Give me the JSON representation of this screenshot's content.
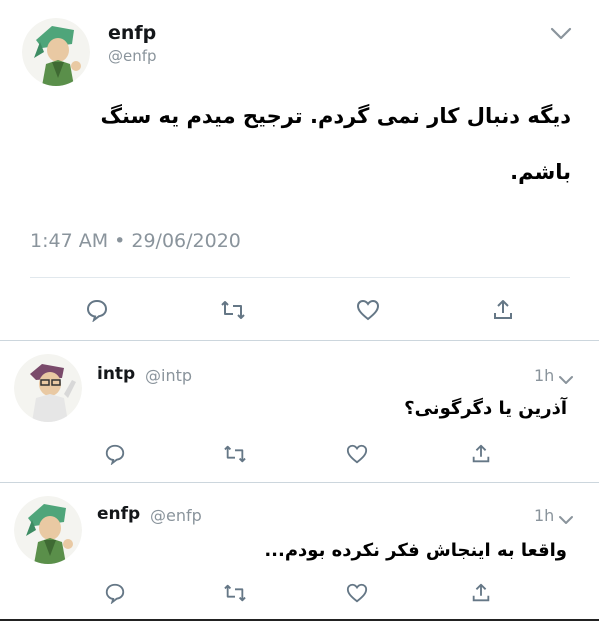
{
  "main_tweet": {
    "display_name": "enfp",
    "handle": "@enfp",
    "text_line1": "دیگه دنبال کار نمی گردم. ترجیح میدم یه سنگ",
    "text_line2": "باشم.",
    "timestamp": "1:47 AM • 29/06/2020",
    "avatar_icon": "enfp-character-avatar",
    "menu_icon": "chevron-down-icon"
  },
  "replies": [
    {
      "display_name": "intp",
      "handle": "@intp",
      "time": "1h",
      "text": "آذرین یا دگرگونی؟",
      "avatar_icon": "intp-character-avatar"
    },
    {
      "display_name": "enfp",
      "handle": "@enfp",
      "time": "1h",
      "text": "واقعا به اینجاش فکر نکرده بودم...",
      "avatar_icon": "enfp-character-avatar"
    }
  ],
  "actions": [
    "reply-icon",
    "retweet-icon",
    "like-icon",
    "share-icon"
  ],
  "colors": {
    "text": "#14171a",
    "muted": "#8a949c",
    "divider": "#e1e8ed",
    "icon": "#657786"
  }
}
